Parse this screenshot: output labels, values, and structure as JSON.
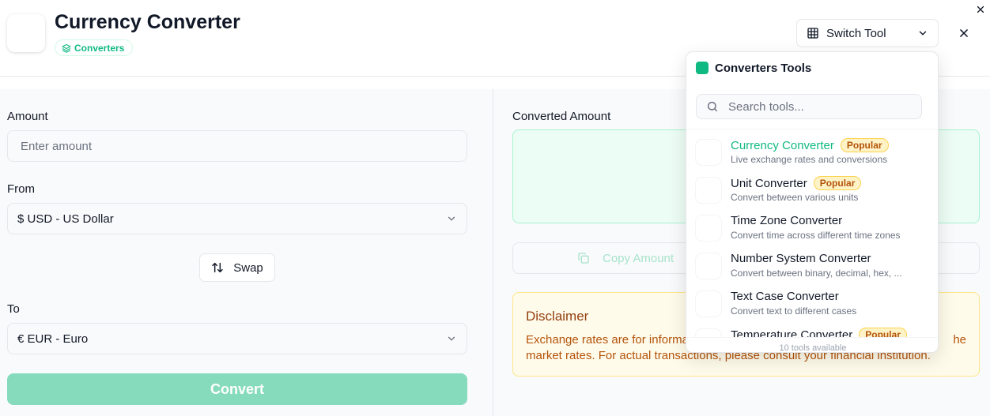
{
  "header": {
    "title": "Currency Converter",
    "category_badge": "Converters",
    "switch_tool_label": "Switch Tool"
  },
  "form": {
    "amount_label": "Amount",
    "amount_placeholder": "Enter amount",
    "from_label": "From",
    "from_value": "$ USD - US Dollar",
    "swap_label": "Swap",
    "to_label": "To",
    "to_value": "€ EUR - Euro",
    "convert_label": "Convert"
  },
  "result": {
    "label": "Converted Amount",
    "copy_label": "Copy Amount"
  },
  "disclaimer": {
    "title": "Disclaimer",
    "text": "Exchange rates are for informa... the market rates. For actual transactions, please consult your financial institution.",
    "line1": "Exchange rates are for informa",
    "line1_end": "he",
    "line2": "market rates. For actual transactions, please consult your financial institution."
  },
  "dropdown": {
    "title": "Converters Tools",
    "search_placeholder": "Search tools...",
    "items": [
      {
        "name": "Currency Converter",
        "desc": "Live exchange rates and conversions",
        "popular": true,
        "active": true
      },
      {
        "name": "Unit Converter",
        "desc": "Convert between various units",
        "popular": true,
        "active": false
      },
      {
        "name": "Time Zone Converter",
        "desc": "Convert time across different time zones",
        "popular": false,
        "active": false
      },
      {
        "name": "Number System Converter",
        "desc": "Convert between binary, decimal, hex, ...",
        "popular": false,
        "active": false
      },
      {
        "name": "Text Case Converter",
        "desc": "Convert text to different cases",
        "popular": false,
        "active": false
      },
      {
        "name": "Temperature Converter",
        "desc": "",
        "popular": true,
        "active": false
      }
    ],
    "popular_label": "Popular",
    "footer": "10 tools available"
  },
  "colors": {
    "accent": "#10b981",
    "convert_button": "#86dbbd",
    "disclaimer_bg": "#fffbeb",
    "result_bg": "#ecfdf5"
  }
}
